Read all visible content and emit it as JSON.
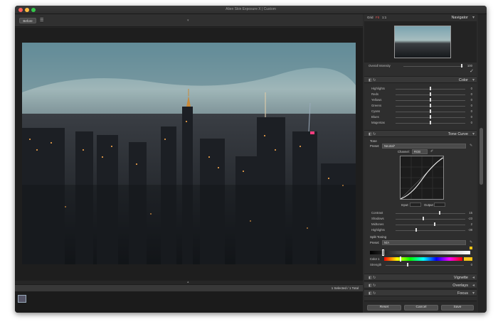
{
  "window": {
    "title": "Alien Skin Exposure X | Custom"
  },
  "toolbar": {
    "before_label": "Before",
    "compare_icon": "list-icon"
  },
  "status": {
    "selected": "1 Selected / 1 Total"
  },
  "navigator": {
    "grid_label": "Grid",
    "fit_label": "Fit",
    "zoom_label": "1:1",
    "title": "Navigator",
    "overall_label": "Overall Intensity",
    "overall_value": "100"
  },
  "color_panel": {
    "title": "Color",
    "rows": [
      {
        "label": "Highlights",
        "value": "0"
      },
      {
        "label": "Reds",
        "value": "0"
      },
      {
        "label": "Yellows",
        "value": "0"
      },
      {
        "label": "Greens",
        "value": "0"
      },
      {
        "label": "Cyans",
        "value": "0"
      },
      {
        "label": "Blues",
        "value": "0"
      },
      {
        "label": "Magentas",
        "value": "0"
      }
    ]
  },
  "tone_panel": {
    "title": "Tone Curve",
    "section": "Tone",
    "preset_label": "Preset:",
    "preset_value": "Neutral*",
    "channel_label": "Channel:",
    "channel_value": "RGB",
    "input_label": "Input:",
    "output_label": "Output:",
    "rows": [
      {
        "label": "Contrast",
        "value": "15"
      },
      {
        "label": "Shadows",
        "value": "-23"
      },
      {
        "label": "Midtones",
        "value": "2"
      },
      {
        "label": "Highlights",
        "value": "-38"
      }
    ],
    "split_title": "Split Toning",
    "split_preset_label": "Preset:",
    "split_preset_value": "N/A",
    "color1_label": "Color 1",
    "strength_label": "Strength",
    "strength_value": "0"
  },
  "collapsed": [
    "Vignette",
    "Overlays",
    "Focus"
  ],
  "footer": {
    "reset": "Reset",
    "cancel": "Cancel",
    "save": "Save"
  }
}
